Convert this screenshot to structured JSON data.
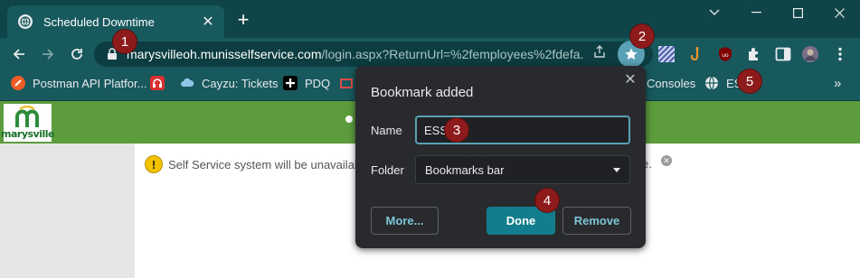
{
  "tab": {
    "title": "Scheduled Downtime"
  },
  "window_controls": [
    "chevron-down",
    "minimize",
    "maximize",
    "close"
  ],
  "toolbar": {
    "url_host": "marysvilleoh.munisselfservice.com",
    "url_path": "/login.aspx?ReturnUrl=%2femployees%2fdefa..."
  },
  "bookmarks": [
    {
      "label": "Postman API Platfor...",
      "icon": "postman-icon"
    },
    {
      "label": "",
      "icon": "headset-icon"
    },
    {
      "label": "Cayzu: Tickets",
      "icon": "cloud-icon"
    },
    {
      "label": "PDQ",
      "icon": "pdq-icon"
    },
    {
      "label": "Consoles",
      "icon": ""
    },
    {
      "label": "ESS",
      "icon": "globe-icon"
    }
  ],
  "page": {
    "logo_text": "marysville",
    "notice_text": "Self Service system will be unavailabl",
    "notice_tail": "e."
  },
  "dialog": {
    "title": "Bookmark added",
    "name_label": "Name",
    "name_value": "ESS",
    "folder_label": "Folder",
    "folder_value": "Bookmarks bar",
    "more_label": "More...",
    "done_label": "Done",
    "remove_label": "Remove"
  },
  "markers": [
    "1",
    "2",
    "3",
    "4",
    "5"
  ],
  "colors": {
    "frame": "#0f4548",
    "toolbar": "#17595c",
    "accent": "#5aa1b5",
    "done": "#127d8c",
    "header_green": "#5c9c3c",
    "marker": "#8e1b1b"
  }
}
